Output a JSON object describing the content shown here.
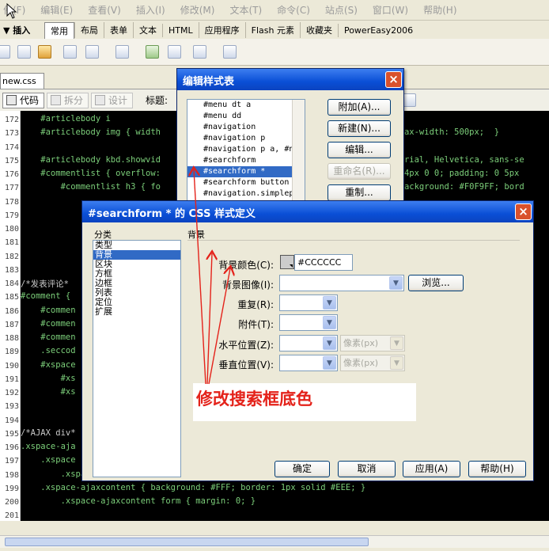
{
  "menubar": [
    "件(F)",
    "编辑(E)",
    "查看(V)",
    "插入(I)",
    "修改(M)",
    "文本(T)",
    "命令(C)",
    "站点(S)",
    "窗口(W)",
    "帮助(H)"
  ],
  "insertbar": {
    "label": "▼ 插入",
    "tabs": [
      "常用",
      "布局",
      "表单",
      "文本",
      "HTML",
      "应用程序",
      "Flash 元素",
      "收藏夹",
      "PowerEasy2006"
    ]
  },
  "file_tab": "new.css",
  "doc_toolbar": {
    "code": "代码",
    "split": "拆分",
    "design": "设计",
    "title_label": "标题:"
  },
  "editor": {
    "line_numbers": [
      "172",
      "173",
      "174",
      "175",
      "176",
      "177",
      "178",
      "179",
      "180",
      "181",
      "182",
      "183",
      "184",
      "185",
      "186",
      "187",
      "188",
      "189",
      "190",
      "191",
      "192",
      "193",
      "194",
      "195",
      "196",
      "197",
      "198",
      "199",
      "200",
      "201"
    ],
    "lines": [
      {
        "text": "    #articlebody i",
        "tail": ""
      },
      {
        "text": "    #articlebody img { width",
        "tail": "; max-width: 500px;  }"
      },
      {
        "text": "",
        "tail": ""
      },
      {
        "text": "    #articlebody kbd.showvid",
        "tail": "n Arial, Helvetica, sans-se"
      },
      {
        "text": "    #commentlist { overflow:",
        "tail": "n: 4px 0 0; padding: 0 5px"
      },
      {
        "text": "        #commentlist h3 { fo",
        "tail": "; background: #F0F9FF; bord"
      },
      {
        "text": "",
        "tail": ""
      },
      {
        "text": "",
        "tail": ""
      },
      {
        "text": "",
        "tail": ""
      },
      {
        "text": "",
        "tail": ""
      },
      {
        "text": "",
        "tail": ""
      },
      {
        "text": "",
        "tail": ""
      },
      {
        "text": "/*发表评论*",
        "tail": ""
      },
      {
        "text": "#comment {",
        "tail": ""
      },
      {
        "text": "    #commen",
        "tail": ""
      },
      {
        "text": "    #commen",
        "tail": ""
      },
      {
        "text": "    #commen",
        "tail": ""
      },
      {
        "text": "    .seccod",
        "tail": ""
      },
      {
        "text": "    #xspace",
        "tail": ""
      },
      {
        "text": "        #xs",
        "tail": ""
      },
      {
        "text": "        #xs",
        "tail": "20p"
      },
      {
        "text": "",
        "tail": ""
      },
      {
        "text": "",
        "tail": ""
      },
      {
        "text": "/*AJAX div*",
        "tail": ""
      },
      {
        "text": ".xspace-aja",
        "tail": ""
      },
      {
        "text": "    .xspace",
        "tail": ""
      },
      {
        "text": "        .xspace-ajaxdiv h3 { float: right; font-weight: normal; }",
        "tail": ""
      },
      {
        "text": "    .xspace-ajaxcontent { background: #FFF; border: 1px solid #EEE; }",
        "tail": ""
      },
      {
        "text": "        .xspace-ajaxcontent form { margin: 0; }",
        "tail": ""
      },
      {
        "text": "",
        "tail": ""
      }
    ]
  },
  "edit_stylesheet_dialog": {
    "title": "编辑样式表",
    "rules": [
      "#menu dt a",
      "#menu dd",
      "#navigation",
      "#navigation p",
      "#navigation p a, #nav",
      "#searchform",
      "#searchform *",
      "#searchform button",
      "#navigation.simplepag"
    ],
    "selected_rule": "#searchform *",
    "buttons": {
      "attach": "附加(A)...",
      "new": "新建(N)...",
      "edit": "编辑...",
      "rename": "重命名(R)...",
      "duplicate": "重制..."
    }
  },
  "css_rule_dialog": {
    "title": "#searchform * 的 CSS 样式定义",
    "category_label": "分类",
    "categories": [
      "类型",
      "背景",
      "区块",
      "方框",
      "边框",
      "列表",
      "定位",
      "扩展"
    ],
    "selected_category": "背景",
    "section_title": "背景",
    "fields": {
      "bg_color": {
        "label": "背景颜色(C):",
        "value": "#CCCCCC",
        "swatch": "#cccccc"
      },
      "bg_image": {
        "label": "背景图像(I):",
        "value": "",
        "browse": "浏览..."
      },
      "repeat": {
        "label": "重复(R):",
        "value": ""
      },
      "attachment": {
        "label": "附件(T):",
        "value": ""
      },
      "h_position": {
        "label": "水平位置(Z):",
        "value": "",
        "unit": "像素(px)"
      },
      "v_position": {
        "label": "垂直位置(V):",
        "value": "",
        "unit": "像素(px)"
      }
    },
    "buttons": {
      "ok": "确定",
      "cancel": "取消",
      "apply": "应用(A)",
      "help": "帮助(H)"
    }
  },
  "annotation": {
    "text": "修改搜索框底色",
    "color": "#e4221a"
  }
}
